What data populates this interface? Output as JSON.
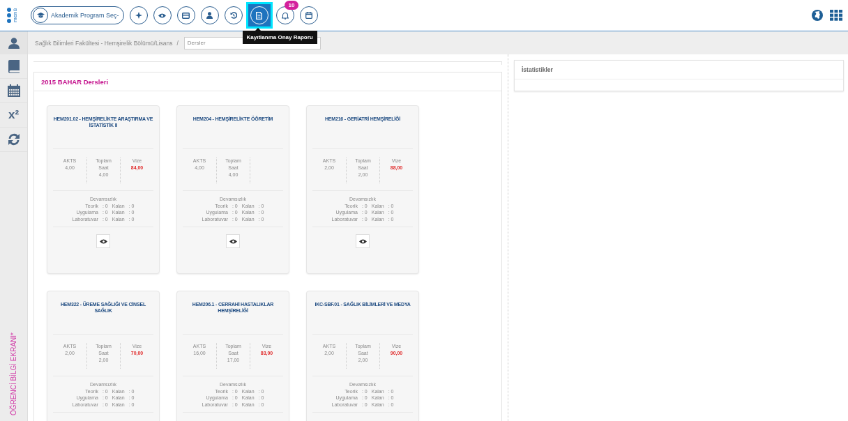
{
  "topbar": {
    "menu_label": "menü",
    "program_button": {
      "label": "Akademik Program Seç-"
    },
    "tools": [
      {
        "kind": "compass",
        "selected": false
      },
      {
        "kind": "eye",
        "selected": false
      },
      {
        "kind": "card",
        "selected": false
      },
      {
        "kind": "user",
        "selected": false
      },
      {
        "kind": "history",
        "selected": false
      },
      {
        "kind": "report",
        "selected": true,
        "tooltip": "Kayıtlanma Onay Raporu"
      },
      {
        "kind": "bell",
        "selected": false,
        "badge": "10"
      },
      {
        "kind": "calendar",
        "selected": false
      }
    ]
  },
  "breadcrumb": {
    "path": "Sağlık Bilimleri Fakültesi - Hemşirelik Bölümü/Lisans",
    "separator": "/",
    "search": {
      "value": "Dersler"
    }
  },
  "sidebar": {
    "items": [
      {
        "kind": "book"
      },
      {
        "kind": "calendar"
      },
      {
        "kind": "superscript",
        "label": "x²"
      },
      {
        "kind": "refresh"
      }
    ],
    "caption": "ÖĞRENCİ BİLGİ EKRANI*"
  },
  "courses_panel": {
    "title": "2015 BAHAR Dersleri",
    "courses": [
      {
        "title": "HEM201.02 - HEMŞİRELİKTE ARAŞTIRMA VE İSTATİSTİK II",
        "stats": [
          {
            "label": "AKTS",
            "value": "4,00",
            "kind": "plain"
          },
          {
            "label": "Toplam Saat",
            "value": "4,00",
            "kind": "plain"
          },
          {
            "label": "Vize",
            "value": "84,00",
            "kind": "grade"
          }
        ],
        "absence_title": "Devamsızlık",
        "absence": [
          {
            "label": "Teorik",
            "count": ": 0",
            "remaining_label": "Kalan",
            "remaining": ": 0"
          },
          {
            "label": "Uygulama",
            "count": ": 0",
            "remaining_label": "Kalan",
            "remaining": ": 0"
          },
          {
            "label": "Laboratuvar",
            "count": ": 0",
            "remaining_label": "Kalan",
            "remaining": ": 0"
          }
        ],
        "view_button": true
      },
      {
        "title": "HEM204 - HEMŞİRELİKTE ÖĞRETİM",
        "stats": [
          {
            "label": "AKTS",
            "value": "4,00",
            "kind": "plain"
          },
          {
            "label": "Toplam Saat",
            "value": "4,00",
            "kind": "plain"
          }
        ],
        "absence_title": "Devamsızlık",
        "absence": [
          {
            "label": "Teorik",
            "count": ": 0",
            "remaining_label": "Kalan",
            "remaining": ": 0"
          },
          {
            "label": "Uygulama",
            "count": ": 0",
            "remaining_label": "Kalan",
            "remaining": ": 0"
          },
          {
            "label": "Laboratuvar",
            "count": ": 0",
            "remaining_label": "Kalan",
            "remaining": ": 0"
          }
        ],
        "view_button": true
      },
      {
        "title": "HEM216 - GERİATRİ HEMŞİRELİĞİ",
        "stats": [
          {
            "label": "AKTS",
            "value": "2,00",
            "kind": "plain"
          },
          {
            "label": "Toplam Saat",
            "value": "2,00",
            "kind": "plain"
          },
          {
            "label": "Vize",
            "value": "88,00",
            "kind": "grade"
          }
        ],
        "absence_title": "Devamsızlık",
        "absence": [
          {
            "label": "Teorik",
            "count": ": 0",
            "remaining_label": "Kalan",
            "remaining": ": 0"
          },
          {
            "label": "Uygulama",
            "count": ": 0",
            "remaining_label": "Kalan",
            "remaining": ": 0"
          },
          {
            "label": "Laboratuvar",
            "count": ": 0",
            "remaining_label": "Kalan",
            "remaining": ": 0"
          }
        ],
        "view_button": true
      },
      {
        "title": "HEM322 - ÜREME SAĞLIĞI VE CİNSEL SAĞLIK",
        "stats": [
          {
            "label": "AKTS",
            "value": "2,00",
            "kind": "plain"
          },
          {
            "label": "Toplam Saat",
            "value": "2,00",
            "kind": "plain"
          },
          {
            "label": "Vize",
            "value": "70,00",
            "kind": "grade"
          }
        ],
        "absence_title": "Devamsızlık",
        "absence": [
          {
            "label": "Teorik",
            "count": ": 0",
            "remaining_label": "Kalan",
            "remaining": ": 0"
          },
          {
            "label": "Uygulama",
            "count": ": 0",
            "remaining_label": "Kalan",
            "remaining": ": 0"
          },
          {
            "label": "Laboratuvar",
            "count": ": 0",
            "remaining_label": "Kalan",
            "remaining": ": 0"
          }
        ],
        "view_button": false
      },
      {
        "title": "HEM206.1 - CERRAHİ HASTALIKLAR HEMŞİRELİĞİ",
        "stats": [
          {
            "label": "AKTS",
            "value": "16,00",
            "kind": "plain"
          },
          {
            "label": "Toplam Saat",
            "value": "17,00",
            "kind": "plain"
          },
          {
            "label": "Vize",
            "value": "83,00",
            "kind": "grade"
          }
        ],
        "absence_title": "Devamsızlık",
        "absence": [
          {
            "label": "Teorik",
            "count": ": 0",
            "remaining_label": "Kalan",
            "remaining": ": 0"
          },
          {
            "label": "Uygulama",
            "count": ": 0",
            "remaining_label": "Kalan",
            "remaining": ": 0"
          },
          {
            "label": "Laboratuvar",
            "count": ": 0",
            "remaining_label": "Kalan",
            "remaining": ": 0"
          }
        ],
        "view_button": false
      },
      {
        "title": "IKC-SBF.01 - SAĞLIK BİLİMLERİ VE MEDYA",
        "stats": [
          {
            "label": "AKTS",
            "value": "2,00",
            "kind": "plain"
          },
          {
            "label": "Toplam Saat",
            "value": "2,00",
            "kind": "plain"
          },
          {
            "label": "Vize",
            "value": "90,00",
            "kind": "grade"
          }
        ],
        "absence_title": "Devamsızlık",
        "absence": [
          {
            "label": "Teorik",
            "count": ": 0",
            "remaining_label": "Kalan",
            "remaining": ": 0"
          },
          {
            "label": "Uygulama",
            "count": ": 0",
            "remaining_label": "Kalan",
            "remaining": ": 0"
          },
          {
            "label": "Laboratuvar",
            "count": ": 0",
            "remaining_label": "Kalan",
            "remaining": ": 0"
          }
        ],
        "view_button": false
      }
    ]
  },
  "stats_panel": {
    "title": "İstatistikler"
  }
}
